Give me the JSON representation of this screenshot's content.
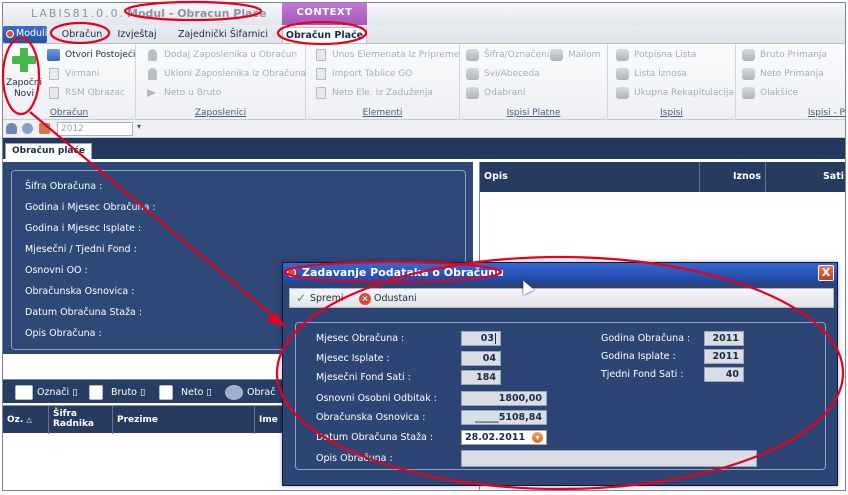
{
  "titlebar": {
    "app_name": "LABIS81.0.0.",
    "window_title": "Modul - Obracun Plaće",
    "context_label": "CONTEXT"
  },
  "menu": {
    "moduli": "Moduli",
    "items": [
      "Obračun",
      "Izvještaj",
      "Zajednički Šifarnici",
      "Obračun Plaće"
    ]
  },
  "ribbon": {
    "zapocni_novi": [
      "Započni",
      "Novi"
    ],
    "obracun": {
      "label": "Obračun",
      "items": [
        "Otvori Postojeći",
        "Virmani",
        "RSM Obrazac"
      ]
    },
    "zaposlenici": {
      "label": "Zaposlenici",
      "items": [
        "Dodaj Zaposlenika u Obračun",
        "Ukloni Zaposlenika iz Obračuna",
        "Neto u Bruto"
      ]
    },
    "elementi": {
      "label": "Elementi",
      "items": [
        "Unos Elemenata Iz Pripreme",
        "Import Tablice GO",
        "Neto Ele. Iz Zaduženja"
      ]
    },
    "ispisi_platne": {
      "label": "Ispisi Platne",
      "items": [
        "Šifra/Označeni",
        "Mailom",
        "Svi/Abeceda",
        "Odabrani"
      ]
    },
    "ispisi": {
      "label": "Ispisi",
      "items": [
        "Potpisna Lista",
        "Lista Iznosa",
        "Ukupna Rekapitulacija"
      ]
    },
    "ispisi_p": {
      "label": "Ispisi - P",
      "items": [
        "Bruto Primanja",
        "Neto Primanja",
        "Olakšice"
      ]
    }
  },
  "toolstrip": {
    "year": "2012"
  },
  "document_tab": "Obračun plaće",
  "info_panel": {
    "rows": [
      "Šifra Obračuna :",
      "Godina i Mjesec Obračuna :",
      "Godina i Mjesec Isplate :",
      "Mjesečni / Tjedni Fond :",
      "Osnovni OO :",
      "Obračunska Osnovica :",
      "Datum Obračuna Staža :",
      "Opis Obračuna :"
    ]
  },
  "lower_toolbar": {
    "items": [
      "Označi",
      "Bruto",
      "Neto",
      "Obrač"
    ]
  },
  "lower_grid": {
    "columns": [
      "Oz.",
      "Šifra Radnika",
      "Prezime",
      "Ime"
    ]
  },
  "right_grid": {
    "columns": [
      "Opis",
      "Iznos",
      "Sati"
    ]
  },
  "dialog": {
    "title": "Zadavanje Podataka o Obračunu",
    "close": "X",
    "save": "Spremi",
    "cancel": "Odustani",
    "fields": {
      "mjesec_obracuna": {
        "label": "Mjesec Obračuna :",
        "value": "03"
      },
      "mjesec_isplate": {
        "label": "Mjesec Isplate :",
        "value": "04"
      },
      "mjesecni_fond_sati": {
        "label": "Mjesečni Fond Sati :",
        "value": "184"
      },
      "osnovni_osobni_odbitak": {
        "label": "Osnovni Osobni Odbitak :",
        "value": "1800,00"
      },
      "obracunska_osnovica": {
        "label": "Obračunska Osnovica :",
        "value": "_____5108,84"
      },
      "datum_obracuna_staza": {
        "label": "Datum Obračuna Staža :",
        "value": "28.02.2011"
      },
      "opis_obracuna": {
        "label": "Opis Obračuna :",
        "value": ""
      },
      "godina_obracuna": {
        "label": "Godina Obračuna :",
        "value": "2011"
      },
      "godina_isplate": {
        "label": "Godina Isplate :",
        "value": "2011"
      },
      "tjedni_fond_sati": {
        "label": "Tjedni Fond Sati :",
        "value": "40"
      }
    }
  },
  "colors": {
    "annotation": "#e8001c",
    "panel_blue": "#2e4878",
    "dialog_title": "#2550b2",
    "context_tab": "#b266c8"
  }
}
